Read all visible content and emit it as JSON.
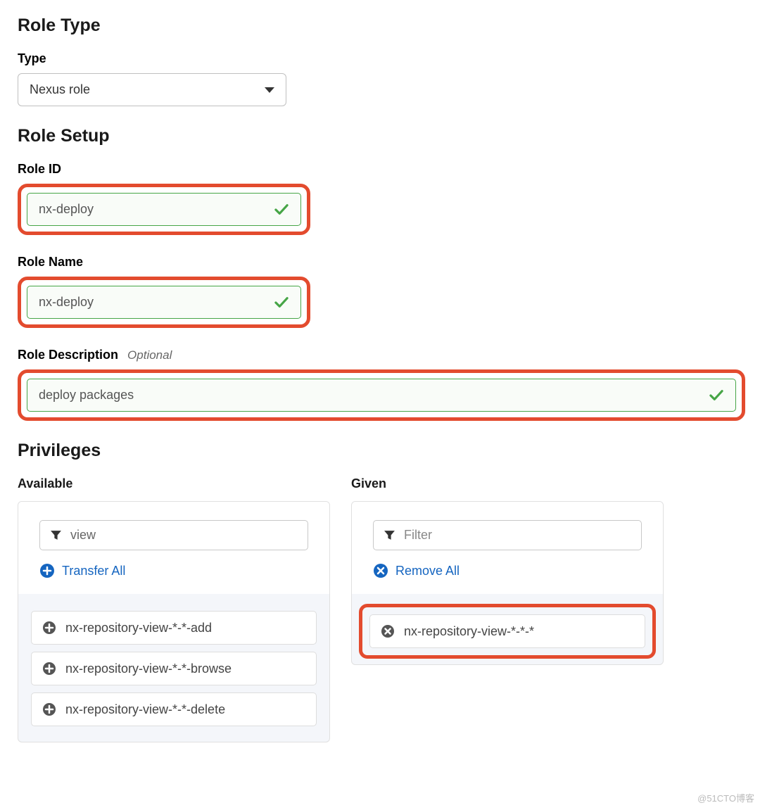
{
  "role_type": {
    "heading": "Role Type",
    "type_label": "Type",
    "type_value": "Nexus role"
  },
  "role_setup": {
    "heading": "Role Setup",
    "role_id_label": "Role ID",
    "role_id_value": "nx-deploy",
    "role_name_label": "Role Name",
    "role_name_value": "nx-deploy",
    "role_desc_label": "Role Description",
    "role_desc_optional": "Optional",
    "role_desc_value": "deploy packages"
  },
  "privileges": {
    "heading": "Privileges",
    "available": {
      "label": "Available",
      "filter_value": "view",
      "transfer_all": "Transfer All",
      "items": [
        "nx-repository-view-*-*-add",
        "nx-repository-view-*-*-browse",
        "nx-repository-view-*-*-delete"
      ]
    },
    "given": {
      "label": "Given",
      "filter_placeholder": "Filter",
      "remove_all": "Remove All",
      "items": [
        "nx-repository-view-*-*-*"
      ]
    }
  },
  "watermark": "@51CTO博客"
}
